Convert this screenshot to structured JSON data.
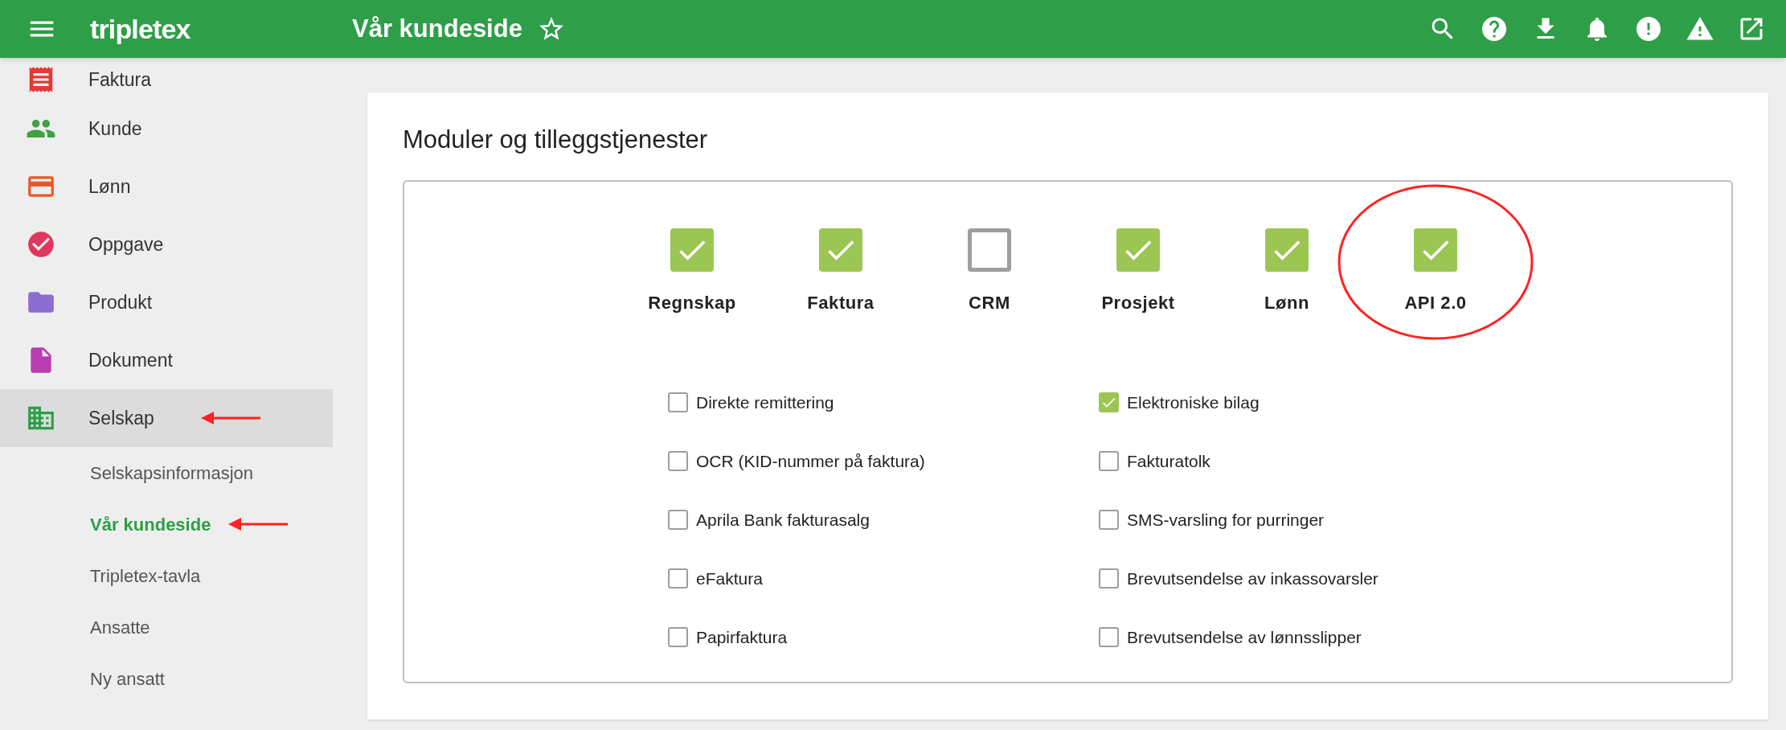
{
  "header": {
    "logo": "tripletex",
    "title": "Vår kundeside",
    "favorite": false
  },
  "sidebar": {
    "items": [
      {
        "label": "Faktura",
        "selected": false,
        "marked": false
      },
      {
        "label": "Kunde",
        "selected": false,
        "marked": false
      },
      {
        "label": "Lønn",
        "selected": false,
        "marked": false
      },
      {
        "label": "Oppgave",
        "selected": false,
        "marked": false
      },
      {
        "label": "Produkt",
        "selected": false,
        "marked": false
      },
      {
        "label": "Dokument",
        "selected": false,
        "marked": false
      },
      {
        "label": "Selskap",
        "selected": true,
        "marked": true,
        "children": [
          {
            "label": "Selskapsinformasjon",
            "selected": false,
            "marked": false
          },
          {
            "label": "Vår kundeside",
            "selected": true,
            "marked": true
          },
          {
            "label": "Tripletex-tavla",
            "selected": false,
            "marked": false
          },
          {
            "label": "Ansatte",
            "selected": false,
            "marked": false
          },
          {
            "label": "Ny ansatt",
            "selected": false,
            "marked": false
          }
        ]
      }
    ]
  },
  "card": {
    "title": "Moduler og tilleggstjenester",
    "modules": [
      {
        "label": "Regnskap",
        "checked": true,
        "marked": false
      },
      {
        "label": "Faktura",
        "checked": true,
        "marked": false
      },
      {
        "label": "CRM",
        "checked": false,
        "marked": false
      },
      {
        "label": "Prosjekt",
        "checked": true,
        "marked": false
      },
      {
        "label": "Lønn",
        "checked": true,
        "marked": false
      },
      {
        "label": "API 2.0",
        "checked": true,
        "marked": true
      }
    ],
    "options": [
      {
        "label": "Direkte remittering",
        "checked": false
      },
      {
        "label": "Elektroniske bilag",
        "checked": true
      },
      {
        "label": "OCR (KID-nummer på faktura)",
        "checked": false
      },
      {
        "label": "Fakturatolk",
        "checked": false
      },
      {
        "label": "Aprila Bank fakturasalg",
        "checked": false
      },
      {
        "label": "SMS-varsling for purringer",
        "checked": false
      },
      {
        "label": "eFaktura",
        "checked": false
      },
      {
        "label": "Brevutsendelse av inkassovarsler",
        "checked": false
      },
      {
        "label": "Papirfaktura",
        "checked": false
      },
      {
        "label": "Brevutsendelse av lønnsslipper",
        "checked": false
      }
    ]
  }
}
